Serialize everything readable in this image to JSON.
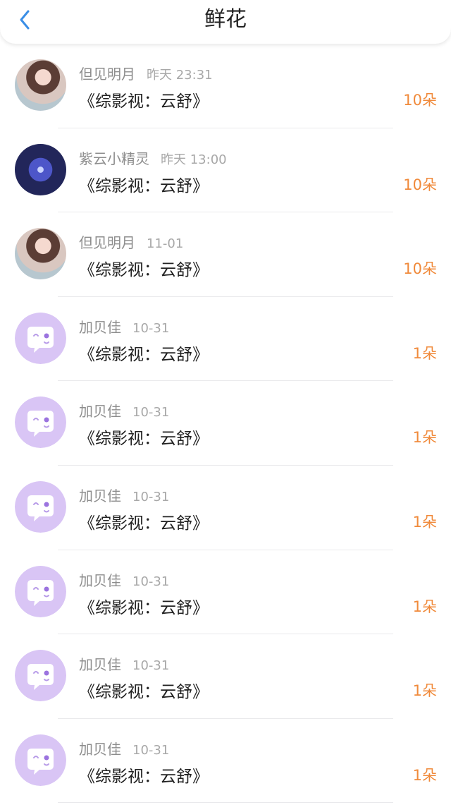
{
  "header": {
    "title": "鲜花"
  },
  "items": [
    {
      "name": "但见明月",
      "time": "昨天 23:31",
      "book": "《综影视：云舒》",
      "count": "10朵",
      "avatar": "photo"
    },
    {
      "name": "紫云小精灵",
      "time": "昨天 13:00",
      "book": "《综影视：云舒》",
      "count": "10朵",
      "avatar": "space"
    },
    {
      "name": "但见明月",
      "time": "11-01",
      "book": "《综影视：云舒》",
      "count": "10朵",
      "avatar": "photo"
    },
    {
      "name": "加贝佳",
      "time": "10-31",
      "book": "《综影视：云舒》",
      "count": "1朵",
      "avatar": "bot"
    },
    {
      "name": "加贝佳",
      "time": "10-31",
      "book": "《综影视：云舒》",
      "count": "1朵",
      "avatar": "bot"
    },
    {
      "name": "加贝佳",
      "time": "10-31",
      "book": "《综影视：云舒》",
      "count": "1朵",
      "avatar": "bot"
    },
    {
      "name": "加贝佳",
      "time": "10-31",
      "book": "《综影视：云舒》",
      "count": "1朵",
      "avatar": "bot"
    },
    {
      "name": "加贝佳",
      "time": "10-31",
      "book": "《综影视：云舒》",
      "count": "1朵",
      "avatar": "bot"
    },
    {
      "name": "加贝佳",
      "time": "10-31",
      "book": "《综影视：云舒》",
      "count": "1朵",
      "avatar": "bot"
    }
  ],
  "colors": {
    "accent": "#3a8ee6",
    "count": "#f08a3b"
  },
  "icons": {
    "back": "chevron-left-icon",
    "avatar_bot": "chat-bubble-icon"
  }
}
